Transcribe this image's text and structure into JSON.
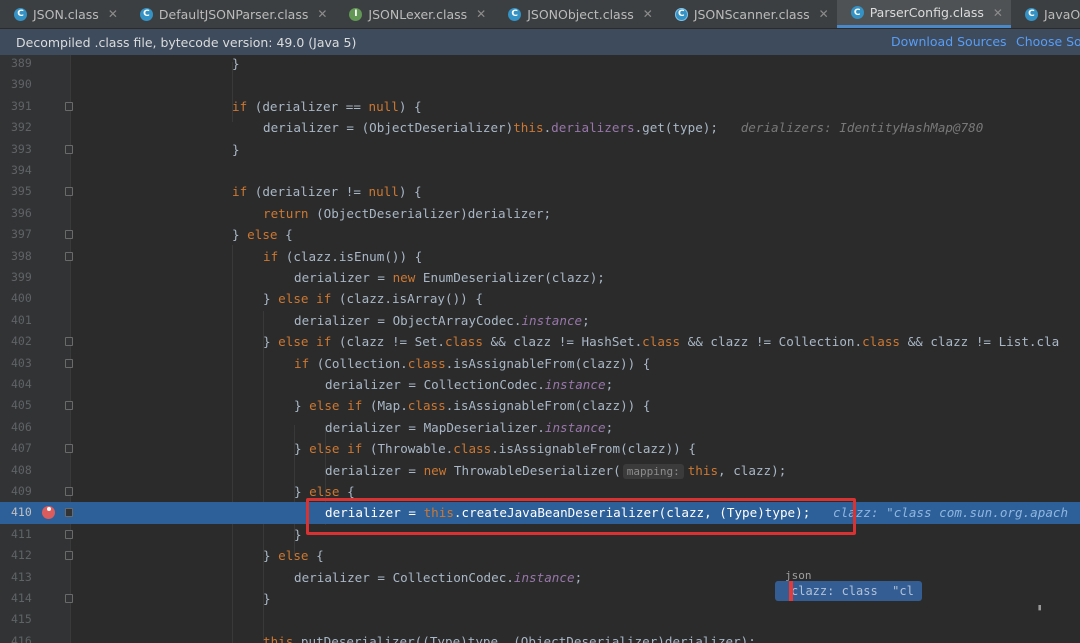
{
  "tabs": [
    {
      "label": "JSON.class",
      "icon": "class-icon",
      "active": false
    },
    {
      "label": "DefaultJSONParser.class",
      "icon": "class-icon",
      "active": false
    },
    {
      "label": "JSONLexer.class",
      "icon": "interface-icon",
      "active": false
    },
    {
      "label": "JSONObject.class",
      "icon": "class-icon",
      "active": false
    },
    {
      "label": "JSONScanner.class",
      "icon": "class-icon",
      "active": false
    },
    {
      "label": "ParserConfig.class",
      "icon": "class-icon",
      "active": true
    },
    {
      "label": "JavaObjectDeserializer.class",
      "icon": "class-icon",
      "active": false
    }
  ],
  "infobar": {
    "message": "Decompiled .class file, bytecode version: 49.0 (Java 5)",
    "download_sources": "Download Sources",
    "choose_sources": "Choose Sou"
  },
  "editor": {
    "execution_line": "410",
    "breakpoint_line": "410",
    "lines": [
      {
        "num": "389",
        "code": "}"
      },
      {
        "num": "390",
        "code": ""
      },
      {
        "num": "391",
        "code": "if (derializer == null) {"
      },
      {
        "num": "392",
        "code": "derializer = (ObjectDeserializer)this.derializers.get(type);",
        "hint": "derializers: IdentityHashMap@780"
      },
      {
        "num": "393",
        "code": "}"
      },
      {
        "num": "394",
        "code": ""
      },
      {
        "num": "395",
        "code": "if (derializer != null) {"
      },
      {
        "num": "396",
        "code": "return (ObjectDeserializer)derializer;"
      },
      {
        "num": "397",
        "code": "} else {"
      },
      {
        "num": "398",
        "code": "if (clazz.isEnum()) {"
      },
      {
        "num": "399",
        "code": "derializer = new EnumDeserializer(clazz);"
      },
      {
        "num": "400",
        "code": "} else if (clazz.isArray()) {"
      },
      {
        "num": "401",
        "code": "derializer = ObjectArrayCodec.instance;"
      },
      {
        "num": "402",
        "code": "} else if (clazz != Set.class && clazz != HashSet.class && clazz != Collection.class && clazz != List.cla"
      },
      {
        "num": "403",
        "code": "if (Collection.class.isAssignableFrom(clazz)) {"
      },
      {
        "num": "404",
        "code": "derializer = CollectionCodec.instance;"
      },
      {
        "num": "405",
        "code": "} else if (Map.class.isAssignableFrom(clazz)) {"
      },
      {
        "num": "406",
        "code": "derializer = MapDeserializer.instance;"
      },
      {
        "num": "407",
        "code": "} else if (Throwable.class.isAssignableFrom(clazz)) {"
      },
      {
        "num": "408",
        "code": "derializer = new ThrowableDeserializer(",
        "param_hint": "mapping:",
        "code_tail": "this, clazz);"
      },
      {
        "num": "409",
        "code": "} else {"
      },
      {
        "num": "410",
        "code": "derializer = this.createJavaBeanDeserializer(clazz, (Type)type);",
        "hint": "clazz: \"class com.sun.org.apach"
      },
      {
        "num": "411",
        "code": "}"
      },
      {
        "num": "412",
        "code": "} else {"
      },
      {
        "num": "413",
        "code": "derializer = CollectionCodec.instance;"
      },
      {
        "num": "414",
        "code": "}"
      },
      {
        "num": "415",
        "code": ""
      },
      {
        "num": "416",
        "code": "this.putDeserializer((Type)type, (ObjectDeserializer)derializer);"
      }
    ]
  },
  "popup": {
    "top_text": "json",
    "text": "clazz: class  \"cl"
  },
  "colors": {
    "accent": "#4a88c7",
    "execution_line": "#2d6099",
    "highlight_box": "#d93232",
    "breakpoint": "#db5c5c"
  }
}
